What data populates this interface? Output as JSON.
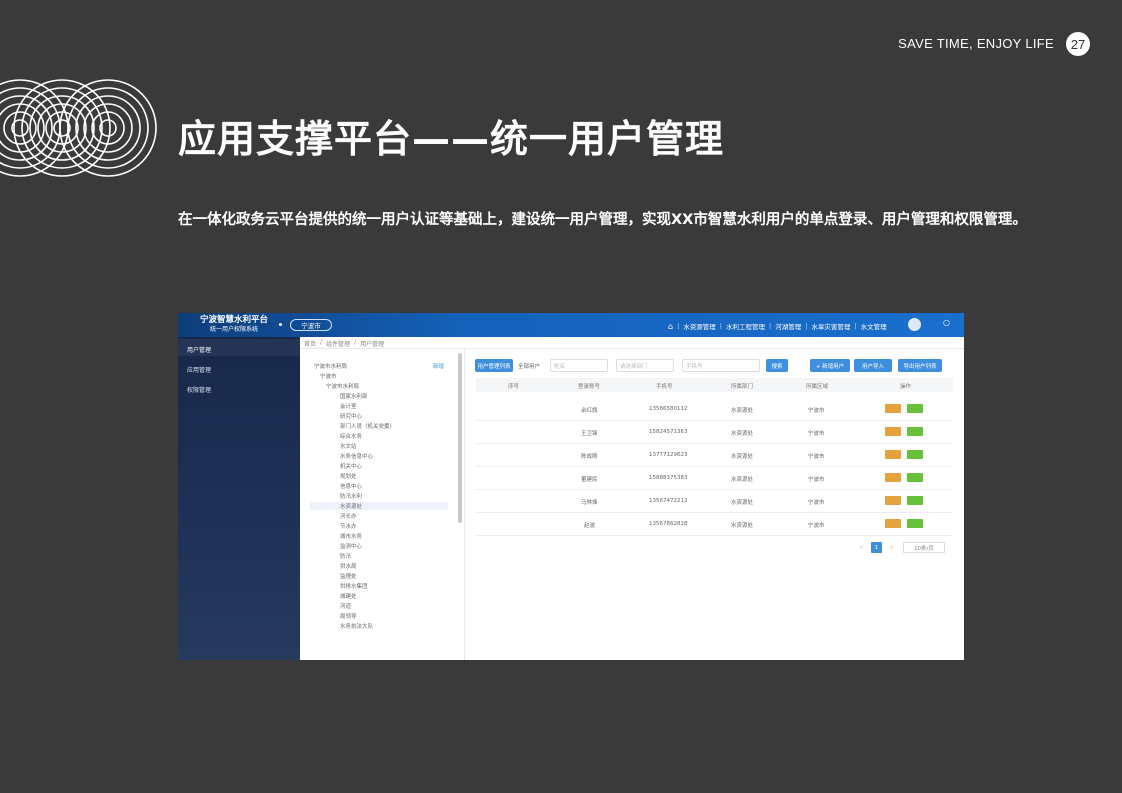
{
  "slide": {
    "tagline": "SAVE TIME, ENJOY LIFE",
    "page_number": "27",
    "title": "应用支撑平台——统一用户管理",
    "description": "在一体化政务云平台提供的统一用户认证等基础上，建设统一用户管理，实现XX市智慧水利用户的单点登录、用户管理和权限管理。"
  },
  "app": {
    "brand_title": "宁波智慧水利平台",
    "brand_subtitle": "统一用户权限系统",
    "city_selector": "宁波市",
    "top_nav": [
      "水资源管理",
      "水利工程管理",
      "河湖管理",
      "水旱灾害管理",
      "水文管理"
    ],
    "sidebar": [
      "用户管理",
      "应用管理",
      "权限管理"
    ],
    "breadcrumb": [
      "首页",
      "组件管理",
      "用户管理"
    ],
    "tree_add": "新增",
    "tree": [
      "宁波市水利局",
      "宁波市",
      "宁波市水利局",
      "国家水利部",
      "会计室",
      "研究中心",
      "部门人员（机关党委）",
      "综合水务",
      "水文站",
      "水务信息中心",
      "机关中心",
      "规划处",
      "信息中心",
      "防汛水利",
      "水资源处",
      "河长办",
      "节水办",
      "城市水务",
      "监测中心",
      "防汛",
      "供水局",
      "监理处",
      "供排水集团",
      "城建处",
      "河道",
      "局领导",
      "水务执法大队"
    ],
    "toolbar": {
      "tab_active": "用户管理列表",
      "tab_plain": "全部用户",
      "input_name": "姓名",
      "input_dept": "请选择部门",
      "input_phone": "手机号",
      "search": "搜索",
      "add_user": "+ 新增用户",
      "import": "用户导入",
      "export": "导出用户列表"
    },
    "table": {
      "headers": [
        "序号",
        "登录账号",
        "手机号",
        "所属部门",
        "所属区域",
        "操作"
      ],
      "rows": [
        {
          "name": "余红旗",
          "phone": "13586580112",
          "dept": "水资源处",
          "region": "宁波市"
        },
        {
          "name": "王卫锋",
          "phone": "15824571363",
          "dept": "水资源处",
          "region": "宁波市"
        },
        {
          "name": "陈成刚",
          "phone": "13777129623",
          "dept": "水资源处",
          "region": "宁波市"
        },
        {
          "name": "董建民",
          "phone": "15888375383",
          "dept": "水资源处",
          "region": "宁波市"
        },
        {
          "name": "马林烽",
          "phone": "13567472212",
          "dept": "水资源处",
          "region": "宁波市"
        },
        {
          "name": "赵波",
          "phone": "13567862828",
          "dept": "水资源处",
          "region": "宁波市"
        }
      ]
    },
    "pager": {
      "prev": "<",
      "current": "1",
      "next": ">",
      "page_size": "10条/页"
    }
  },
  "colors": {
    "slide_background": "#3a3a3a",
    "primary": "#3f8fe0",
    "edit": "#e6a23c",
    "delete": "#67c23a"
  }
}
